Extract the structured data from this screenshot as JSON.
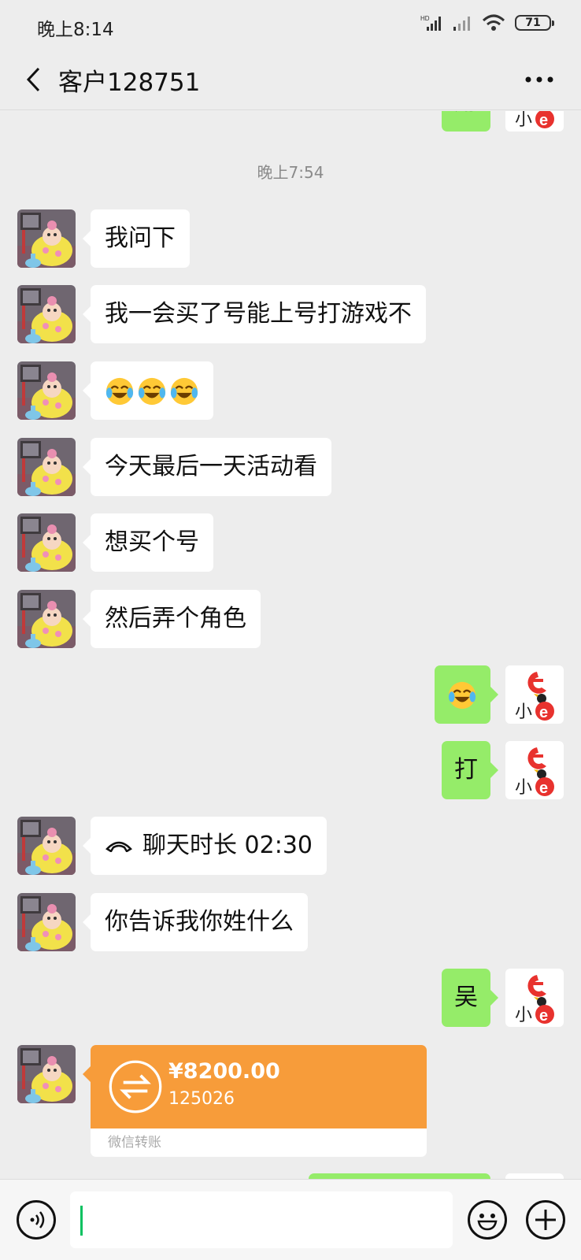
{
  "status_bar": {
    "time": "晚上8:14",
    "battery": "71",
    "icons": [
      "hd-signal-icon",
      "signal-icon",
      "wifi-icon",
      "battery-icon"
    ]
  },
  "nav": {
    "back_icon": "chevron-left-icon",
    "title": "客户128751",
    "more_icon": "more-dots-icon"
  },
  "chat": {
    "partial_top_message": "用",
    "timestamp": "晚上7:54",
    "messages": [
      {
        "from": "contact",
        "type": "text",
        "text": "我问下"
      },
      {
        "from": "contact",
        "type": "text",
        "text": "我一会买了号能上号打游戏不"
      },
      {
        "from": "contact",
        "type": "emoji",
        "emojis": [
          "laugh-cry-emoji",
          "laugh-cry-emoji",
          "laugh-cry-emoji"
        ]
      },
      {
        "from": "contact",
        "type": "text",
        "text": "今天最后一天活动看"
      },
      {
        "from": "contact",
        "type": "text",
        "text": "想买个号"
      },
      {
        "from": "contact",
        "type": "text",
        "text": "然后弄个角色"
      },
      {
        "from": "me",
        "type": "emoji",
        "emojis": [
          "laugh-cry-emoji"
        ]
      },
      {
        "from": "me",
        "type": "text",
        "text": "打"
      },
      {
        "from": "contact",
        "type": "call",
        "text": "聊天时长 02:30"
      },
      {
        "from": "contact",
        "type": "text",
        "text": "你告诉我你姓什么"
      },
      {
        "from": "me",
        "type": "text",
        "text": "吴"
      },
      {
        "from": "contact",
        "type": "transfer",
        "amount": "¥8200.00",
        "note": "125026",
        "label": "微信转账"
      }
    ]
  },
  "input_bar": {
    "voice_icon": "voice-icon",
    "text_value": "",
    "emoji_icon": "emoji-icon",
    "plus_icon": "plus-icon"
  },
  "colors": {
    "background": "#ededed",
    "outgoing_bubble": "#95ec69",
    "incoming_bubble": "#ffffff",
    "transfer": "#f79c3a",
    "accent": "#07c160"
  }
}
